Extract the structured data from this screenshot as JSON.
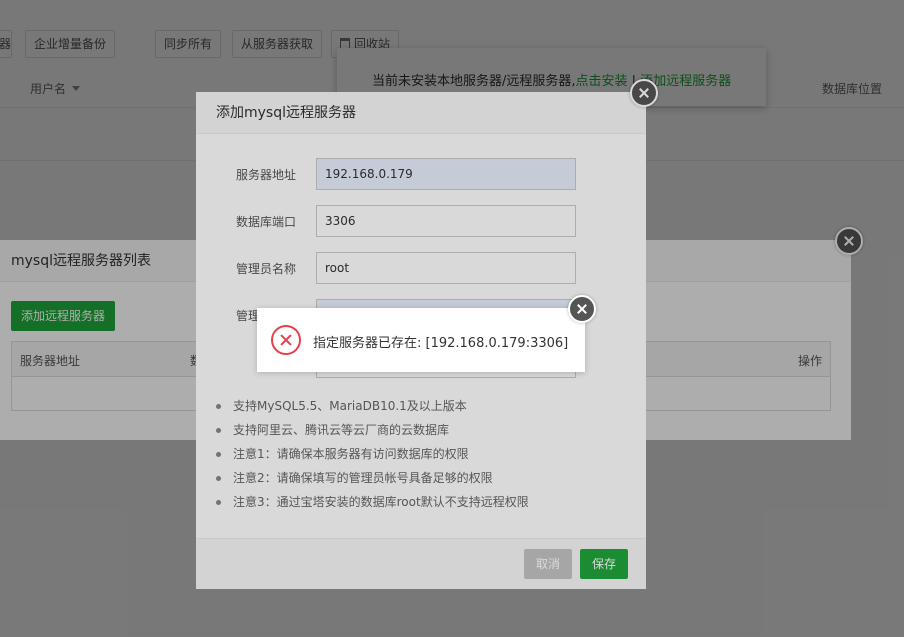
{
  "toolbar": {
    "partial_label": "器",
    "enterprise_backup": "企业增量备份",
    "sync_all": "同步所有",
    "fetch_from_server": "从服务器获取",
    "recycle_bin": "回收站"
  },
  "table_header": {
    "username": "用户名",
    "db_location": "数据库位置"
  },
  "notice": {
    "text": "当前未安装本地服务器/远程服务器,",
    "install_link": "点击安装",
    "separator": " | ",
    "add_remote_link": "添加远程服务器"
  },
  "list_panel": {
    "title": "mysql远程服务器列表",
    "add_button": "添加远程服务器",
    "columns": {
      "address": "服务器地址",
      "port_partial": "数",
      "operation": "操作"
    }
  },
  "add_dialog": {
    "title": "添加mysql远程服务器",
    "fields": {
      "address_label": "服务器地址",
      "address_value": "192.168.0.179",
      "port_label": "数据库端口",
      "port_value": "3306",
      "admin_name_label": "管理员名称",
      "admin_name_value": "root",
      "admin_pass_label": "管理"
    },
    "notes": [
      "支持MySQL5.5、MariaDB10.1及以上版本",
      "支持阿里云、腾讯云等云厂商的云数据库",
      "注意1：请确保本服务器有访问数据库的权限",
      "注意2：请确保填写的管理员帐号具备足够的权限",
      "注意3：通过宝塔安装的数据库root默认不支持远程权限"
    ],
    "cancel_label": "取消",
    "save_label": "保存"
  },
  "error": {
    "message": "指定服务器已存在: [192.168.0.179:3306]"
  },
  "colors": {
    "brand_green": "#20a53a",
    "error_red": "#e8404a"
  },
  "icons": [
    "trash-icon",
    "caret-down-icon",
    "close-icon",
    "error-icon"
  ]
}
